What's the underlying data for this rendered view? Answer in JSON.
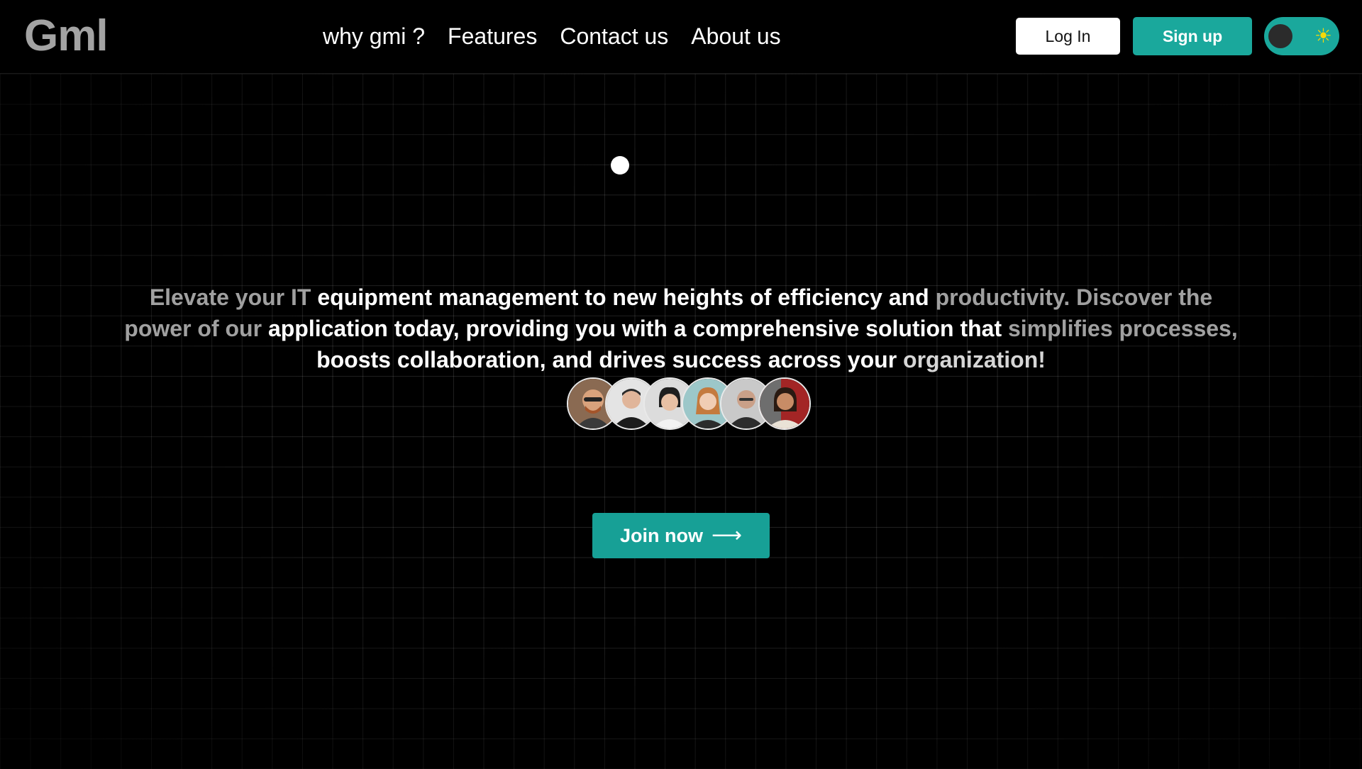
{
  "header": {
    "logo": "Gml",
    "nav": [
      "why gmi ?",
      "Features",
      "Contact us",
      "About us"
    ],
    "login_label": "Log In",
    "signup_label": "Sign up",
    "theme_toggle_icon": "sun-icon"
  },
  "hero": {
    "text_part1": "Elevate your IT ",
    "text_part2": "equipment management to new heights of efficiency and ",
    "text_part3": "productivity. Discover the power of our ",
    "text_part4": "application today, providing you with a comprehensive solution that ",
    "text_part5": "simplifies processes, ",
    "text_part6": "boosts collaboration, and drives success across your ",
    "text_part7": "organization!",
    "avatars": [
      "avatar-1",
      "avatar-2",
      "avatar-3",
      "avatar-4",
      "avatar-5",
      "avatar-6"
    ],
    "cta_label": "Join now",
    "cta_icon": "arrow-right-icon"
  },
  "colors": {
    "accent": "#1aa89c",
    "background": "#000000",
    "logo": "#a3a3a3"
  }
}
